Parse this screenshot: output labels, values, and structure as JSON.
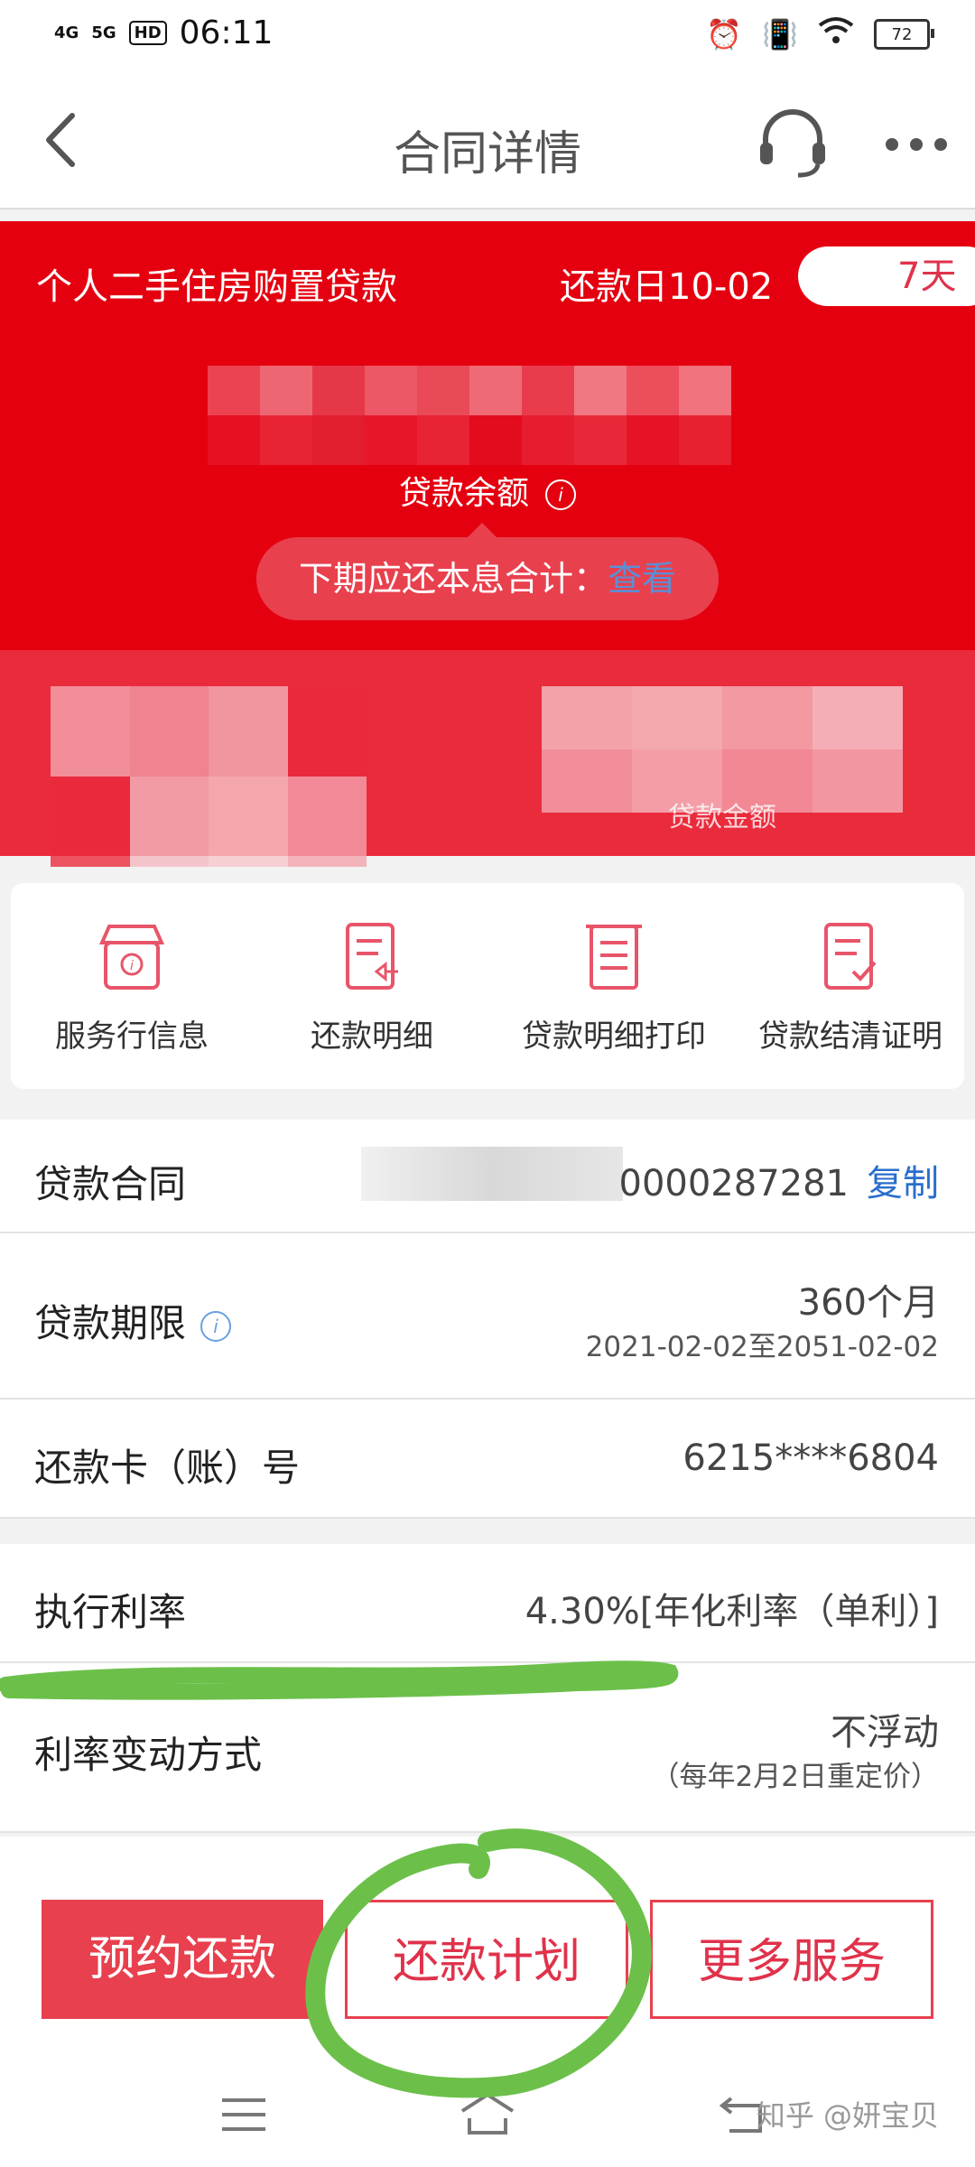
{
  "status_bar": {
    "signal_1": "4G",
    "signal_2": "5G",
    "hd": "HD",
    "time": "06:11",
    "battery": "72"
  },
  "header": {
    "title": "合同详情",
    "back_icon": "chevron-left-icon",
    "service_icon": "headset-icon",
    "more_icon": "more-dots-icon"
  },
  "loan_card": {
    "loan_type": "个人二手住房购置贷款",
    "repayment_day": "还款日10-02",
    "days_left": "7天",
    "balance_label": "贷款余额",
    "next_due_label": "下期应还本息合计：",
    "next_due_link": "查看",
    "band_label": "贷款金额"
  },
  "quick_actions": [
    {
      "label": "服务行信息",
      "icon": "bank-info-icon"
    },
    {
      "label": "还款明细",
      "icon": "repayment-detail-icon"
    },
    {
      "label": "贷款明细打印",
      "icon": "print-doc-icon"
    },
    {
      "label": "贷款结清证明",
      "icon": "settlement-certificate-icon"
    }
  ],
  "details": {
    "contract_label": "贷款合同",
    "contract_value": "0000287281",
    "copy_label": "复制",
    "term_label": "贷款期限",
    "term_value": "360个月",
    "term_range": "2021-02-02至2051-02-02",
    "card_label": "还款卡（账）号",
    "card_value": "6215****6804",
    "rate_label": "执行利率",
    "rate_value": "4.30%[年化利率（单利）]",
    "rate_change_label": "利率变动方式",
    "rate_change_value": "不浮动",
    "rate_change_note": "（每年2月2日重定价）"
  },
  "actions": {
    "prepay": "预约还款",
    "plan": "还款计划",
    "more": "更多服务"
  },
  "watermark": "知乎 @妍宝贝",
  "colors": {
    "brand_red": "#e4000f",
    "button_red": "#e8404e",
    "link_blue": "#2a6ecc",
    "highlight_green": "#6cc04a"
  }
}
